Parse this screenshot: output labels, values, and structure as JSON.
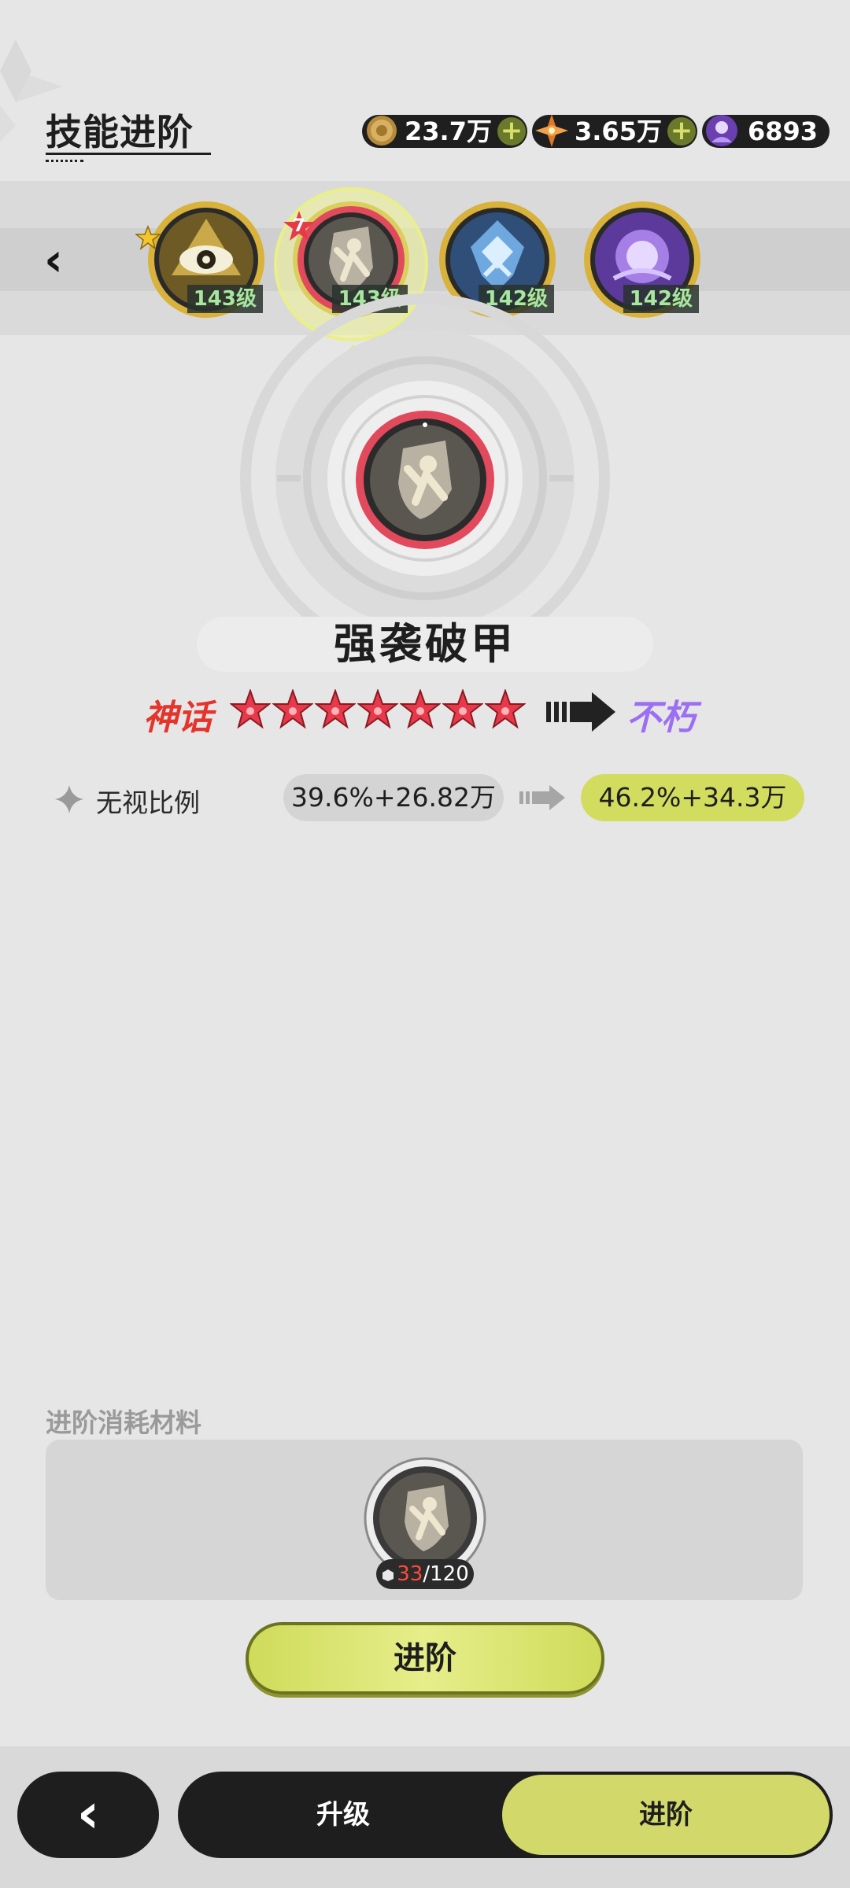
{
  "header": {
    "title": "技能进阶"
  },
  "currencies": [
    {
      "icon": "gold-coin-icon",
      "value": "23.7万",
      "has_plus": true
    },
    {
      "icon": "orange-crystal-icon",
      "value": "3.65万",
      "has_plus": true
    },
    {
      "icon": "purple-character-icon",
      "value": "6893",
      "has_plus": false
    }
  ],
  "skill_selector": {
    "skills": [
      {
        "icon": "eye-skill-icon",
        "level": "143级",
        "selected": false,
        "badge": "star"
      },
      {
        "icon": "shield-strike-skill-icon",
        "level": "143级",
        "selected": true,
        "badge": "7"
      },
      {
        "icon": "blue-crest-skill-icon",
        "level": "142级",
        "selected": false
      },
      {
        "icon": "purple-orb-skill-icon",
        "level": "142级",
        "selected": false
      }
    ]
  },
  "skill_detail": {
    "name": "强袭破甲",
    "rarity_current": "神话",
    "star_count": 7,
    "rarity_next": "不朽",
    "attribute": {
      "label": "无视比例",
      "current": "39.6%+26.82万",
      "next": "46.2%+34.3万"
    }
  },
  "materials": {
    "title": "进阶消耗材料",
    "item": {
      "icon": "shield-strike-fragment-icon",
      "have": "33",
      "need": "/120"
    }
  },
  "advance_button": {
    "label": "进阶"
  },
  "bottom_nav": {
    "upgrade_label": "升级",
    "advance_label": "进阶"
  },
  "colors": {
    "accent": "#d2dc5e",
    "mythic_red": "#e3352c",
    "immortal_purple": "#9c6ff2",
    "level_green": "#a7e7a0"
  }
}
